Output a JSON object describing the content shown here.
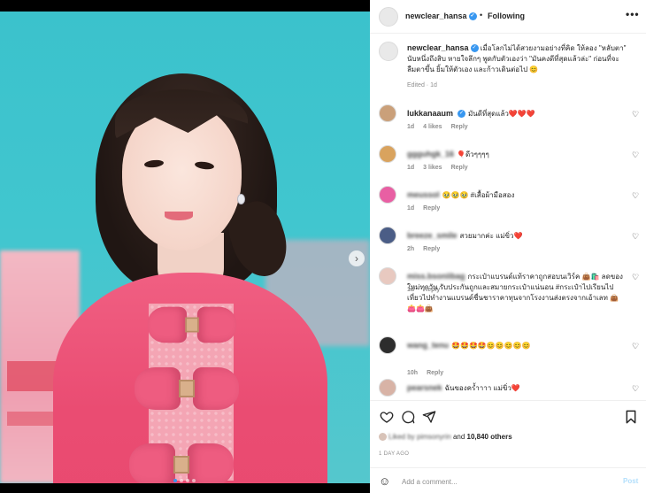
{
  "post": {
    "author": "newclear_hansa",
    "follow_label": "Following",
    "separator": "•",
    "more_glyph": "•••",
    "caption_author": "newclear_hansa",
    "caption": "เมื่อโลกไม่ได้สวยงามอย่างที่คิด ให้ลอง \"หลับตา\" นับหนึ่งถึงสิบ หายใจลึกๆ พูดกับตัวเองว่า \"มันคงดีที่สุดแล้วล่ะ\" ก่อนที่จะลืมตาขึ้น ยิ้มให้ตัวเอง และก้าวเดินต่อไป 😊",
    "caption_meta": "Edited · 1d",
    "media": {
      "slide_count": 4,
      "active_slide": 1,
      "next_glyph": "›"
    }
  },
  "comments": [
    {
      "user": "lukkanaaum",
      "user_blurred": false,
      "verified": true,
      "text": "มันดีที่สุดแล้ว❤️❤️❤️",
      "time": "1d",
      "likes": "4 likes",
      "reply": "Reply"
    },
    {
      "user": "ggguhgk_16",
      "user_blurred": true,
      "verified": false,
      "text": "🎈ดีวๆๆๆๆ",
      "time": "1d",
      "likes": "3 likes",
      "reply": "Reply"
    },
    {
      "user": "meussol",
      "user_blurred": true,
      "verified": false,
      "text": "🥹🥹🥹 #เสื้อผ้ามือสอง",
      "time": "1d",
      "likes": "",
      "reply": "Reply"
    },
    {
      "user": "breeze_smile",
      "user_blurred": true,
      "verified": false,
      "text": "สวยมากค่ะ แม่ขิ่ว❤️",
      "time": "2h",
      "likes": "",
      "reply": "Reply"
    },
    {
      "user": "miss.bsoniibag",
      "user_blurred": true,
      "verified": false,
      "text": "กระเป๋าแบรนด์แท้ราคาถูกสอบนเวิร์ค 👜🛍️ ลดของใหม่ทุกวัน รับประกันถูกและสมายกระเป๋าแน่นอน #กระเป๋าไปเรียนไปเที่ยวไปทำงานแบรนด์ชื่นชาราคาทุนจากโรงงานส่งตรงจากเอ้าเลท 👜👛👛👜",
      "time": "1d",
      "likes": "",
      "reply": "Reply"
    },
    {
      "user": "wang_tenu",
      "user_blurred": true,
      "verified": false,
      "text": "🤩🤩🤩🤩😊😊😊😊😊",
      "time": "10h",
      "likes": "",
      "reply": "Reply"
    },
    {
      "user": "pearsnek",
      "user_blurred": true,
      "verified": false,
      "text": "ฉันของครํ้าาาา แม่ขิ่ว❤️",
      "time": "",
      "likes": "",
      "reply": ""
    }
  ],
  "actions": {
    "like_icon": "heart-outline",
    "comment_icon": "speech-bubble",
    "share_icon": "paper-plane",
    "save_icon": "bookmark"
  },
  "likes": {
    "liked_by": "Liked by pimsonyrin",
    "and_text": "and",
    "others": "10,840 others"
  },
  "time_ago": "1 DAY AGO",
  "add_comment": {
    "placeholder": "Add a comment...",
    "post_label": "Post",
    "emoji_icon": "smiley"
  },
  "colors": {
    "accent": "#3897f0",
    "post_disabled": "#b2dffc",
    "background": "#000000"
  }
}
